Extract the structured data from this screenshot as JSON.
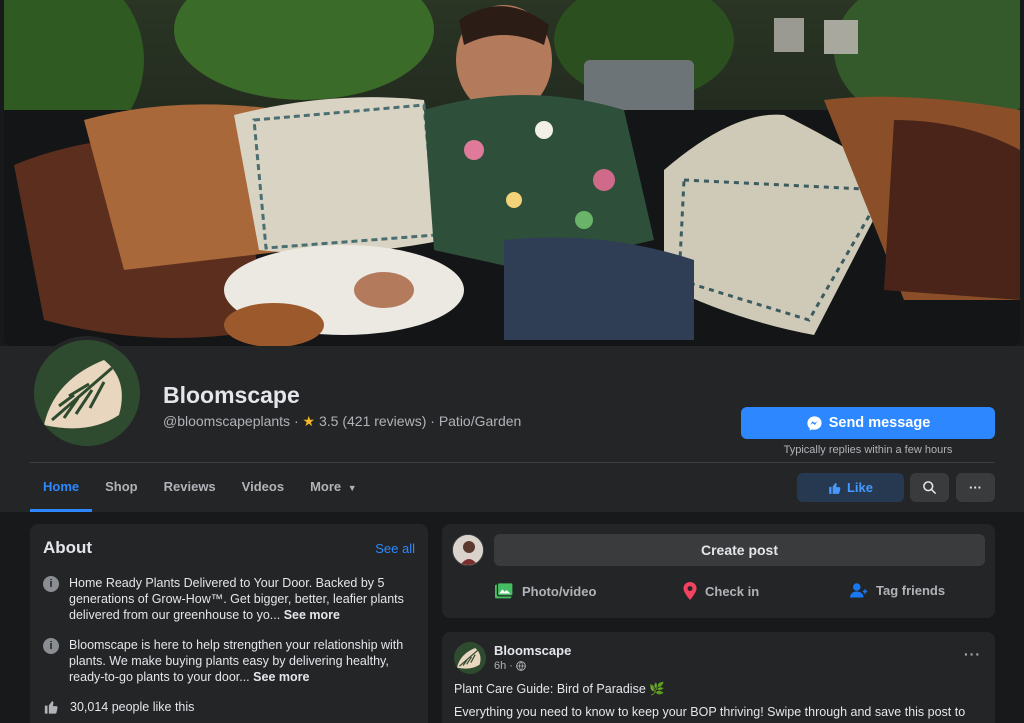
{
  "page": {
    "name": "Bloomscape",
    "handle": "@bloomscapeplants",
    "separator": "·",
    "rating": "3.5",
    "reviews": "(421 reviews)",
    "category": "Patio/Garden"
  },
  "actions": {
    "send_message": "Send message",
    "reply_note": "Typically replies within a few hours",
    "like": "Like",
    "more_dots": "···"
  },
  "tabs": [
    {
      "label": "Home"
    },
    {
      "label": "Shop"
    },
    {
      "label": "Reviews"
    },
    {
      "label": "Videos"
    },
    {
      "label": "More"
    }
  ],
  "about": {
    "title": "About",
    "see_all": "See all",
    "items": [
      {
        "text": "Home Ready Plants Delivered to Your Door. Backed by 5 generations of Grow-How™. Get bigger, better, leafier plants delivered from our greenhouse to yo...",
        "more": "See more"
      },
      {
        "text": "Bloomscape is here to help strengthen your relationship with plants. We make buying plants easy by delivering healthy, ready-to-go plants to your door...",
        "more": "See more"
      }
    ],
    "likes": "30,014 people like this"
  },
  "create_post": {
    "label": "Create post",
    "photo_video": "Photo/video",
    "check_in": "Check in",
    "tag_friends": "Tag friends"
  },
  "post": {
    "author": "Bloomscape",
    "time": "6h ·",
    "title": "Plant Care Guide: Bird of Paradise 🌿",
    "body": "Everything you need to know to keep your BOP thriving! Swipe through and save this post to"
  },
  "colors": {
    "accent": "#2d88ff",
    "background": "#18191a",
    "card": "#242526",
    "like_bg": "#263951"
  }
}
